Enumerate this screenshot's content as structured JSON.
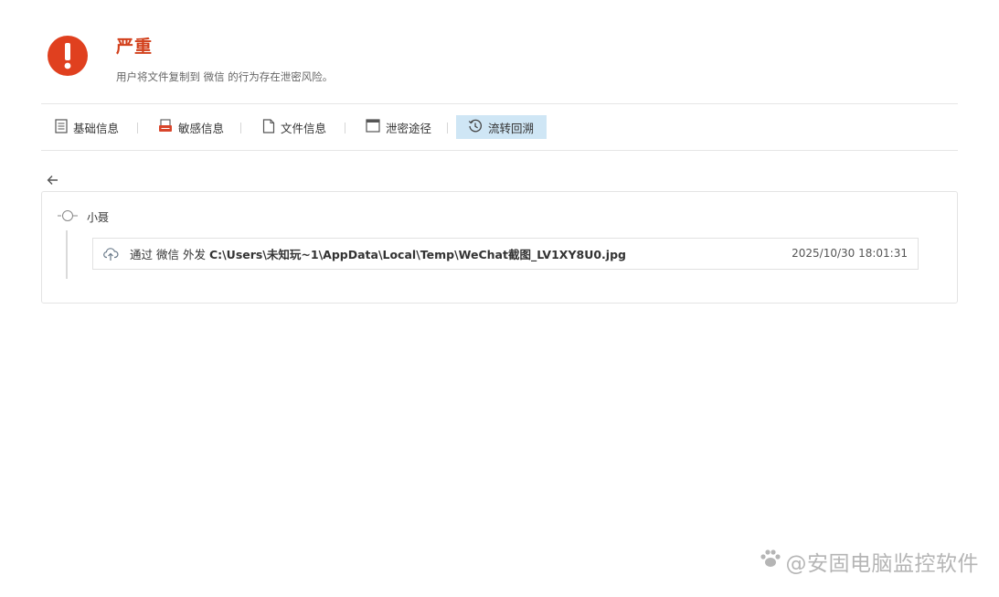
{
  "alert": {
    "icon": "exclamation-circle-icon",
    "severity": "严重",
    "description": "用户将文件复制到 微信 的行为存在泄密风险。",
    "color": "#e0401f"
  },
  "tabs": [
    {
      "label": "基础信息",
      "icon": "document-list-icon",
      "active": false
    },
    {
      "label": "敏感信息",
      "icon": "sensitive-doc-icon",
      "active": false
    },
    {
      "label": "文件信息",
      "icon": "file-icon",
      "active": false
    },
    {
      "label": "泄密途径",
      "icon": "window-icon",
      "active": false
    },
    {
      "label": "流转回溯",
      "icon": "history-clock-icon",
      "active": true
    }
  ],
  "trace": {
    "user": "小聂",
    "record": {
      "prefix": "通过 微信 外发",
      "path": "C:\\Users\\未知玩~1\\AppData\\Local\\Temp\\WeChat截图_LV1XY8U0.jpg",
      "time": "2025/10/30 18:01:31",
      "icon": "cloud-upload-icon"
    }
  },
  "watermark": "@安固电脑监控软件",
  "colors": {
    "accent": "#cfe6f5",
    "danger": "#d2401c"
  }
}
